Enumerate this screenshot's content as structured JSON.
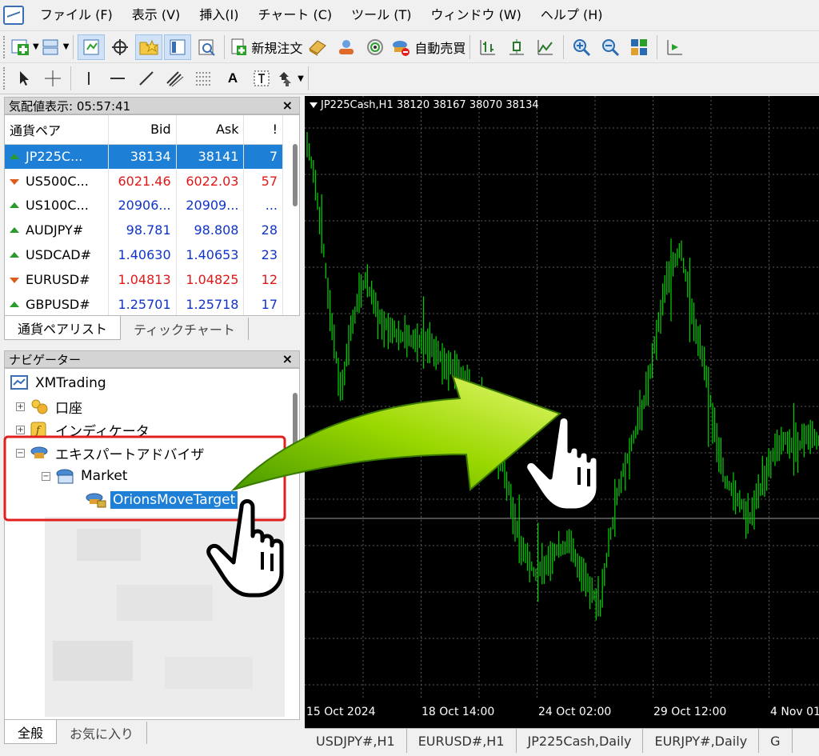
{
  "menu": [
    "ファイル (F)",
    "表示 (V)",
    "挿入(I)",
    "チャート (C)",
    "ツール (T)",
    "ウィンドウ (W)",
    "ヘルプ (H)"
  ],
  "toolbar": {
    "new_order": "新規注文",
    "auto_trading": "自動売買",
    "text_tool": "A"
  },
  "market_watch": {
    "title": "気配値表示: 05:57:41",
    "columns": [
      "通貨ペア",
      "Bid",
      "Ask",
      "!"
    ],
    "rows": [
      {
        "symbol": "JP225C...",
        "bid": "38134",
        "ask": "38141",
        "spread": "7",
        "dir": "up",
        "color": "blue"
      },
      {
        "symbol": "US500C...",
        "bid": "6021.46",
        "ask": "6022.03",
        "spread": "57",
        "dir": "down",
        "color": "red"
      },
      {
        "symbol": "US100C...",
        "bid": "20906...",
        "ask": "20909...",
        "spread": "...",
        "dir": "up",
        "color": "blue"
      },
      {
        "symbol": "AUDJPY#",
        "bid": "98.781",
        "ask": "98.808",
        "spread": "28",
        "dir": "up",
        "color": "blue"
      },
      {
        "symbol": "USDCAD#",
        "bid": "1.40630",
        "ask": "1.40653",
        "spread": "23",
        "dir": "up",
        "color": "blue"
      },
      {
        "symbol": "EURUSD#",
        "bid": "1.04813",
        "ask": "1.04825",
        "spread": "12",
        "dir": "down",
        "color": "red"
      },
      {
        "symbol": "GBPUSD#",
        "bid": "1.25701",
        "ask": "1.25718",
        "spread": "17",
        "dir": "up",
        "color": "blue"
      }
    ],
    "tabs": [
      "通貨ペアリスト",
      "ティックチャート"
    ]
  },
  "navigator": {
    "title": "ナビゲーター",
    "root": "XMTrading",
    "items": [
      "口座",
      "インディケータ",
      "エキスパートアドバイザ",
      "Market",
      "OrionsMoveTarget"
    ],
    "tabs": [
      "全般",
      "お気に入り"
    ]
  },
  "chart": {
    "title": "JP225Cash,H1  38120 38167 38070 38134",
    "x_labels": [
      "15 Oct 2024",
      "18 Oct 14:00",
      "24 Oct 02:00",
      "29 Oct 12:00",
      "4 Nov 01:"
    ],
    "tabs": [
      "USDJPY#,H1",
      "EURUSD#,H1",
      "JP225Cash,Daily",
      "EURJPY#,Daily",
      "G"
    ],
    "candle_color": "#00c800",
    "grid_color": "#5a5a5a"
  },
  "annotation": {
    "highlight_color": "#e02020",
    "arrow_color": "#8fd400"
  }
}
